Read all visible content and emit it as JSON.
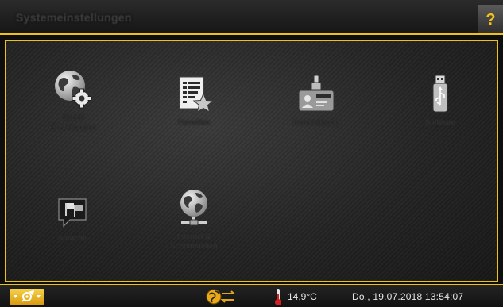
{
  "header": {
    "title": "Systemeinstellungen",
    "help_label": "?"
  },
  "tiles": [
    {
      "label": "Einheit\nEinstellungen",
      "icon": "globe-gear-icon"
    },
    {
      "label": "Favoriten",
      "icon": "document-star-icon"
    },
    {
      "label": "Berechtigung",
      "icon": "id-badge-icon"
    },
    {
      "label": "Software",
      "icon": "usb-stick-icon"
    },
    {
      "label": "Sprache",
      "icon": "language-flags-icon"
    },
    {
      "label": "Internet &\nSchnittstellen",
      "icon": "globe-network-icon"
    }
  ],
  "footer": {
    "tools_icon": "tools-menu-icon",
    "network_icon": "network-transfer-icon",
    "thermometer_icon": "thermometer-icon",
    "temperature": "14,9°C",
    "datetime": "Do., 19.07.2018 13:54:07"
  },
  "colors": {
    "accent": "#f0c01a",
    "background": "#1c1c1c",
    "thermometer": "#d02020"
  }
}
